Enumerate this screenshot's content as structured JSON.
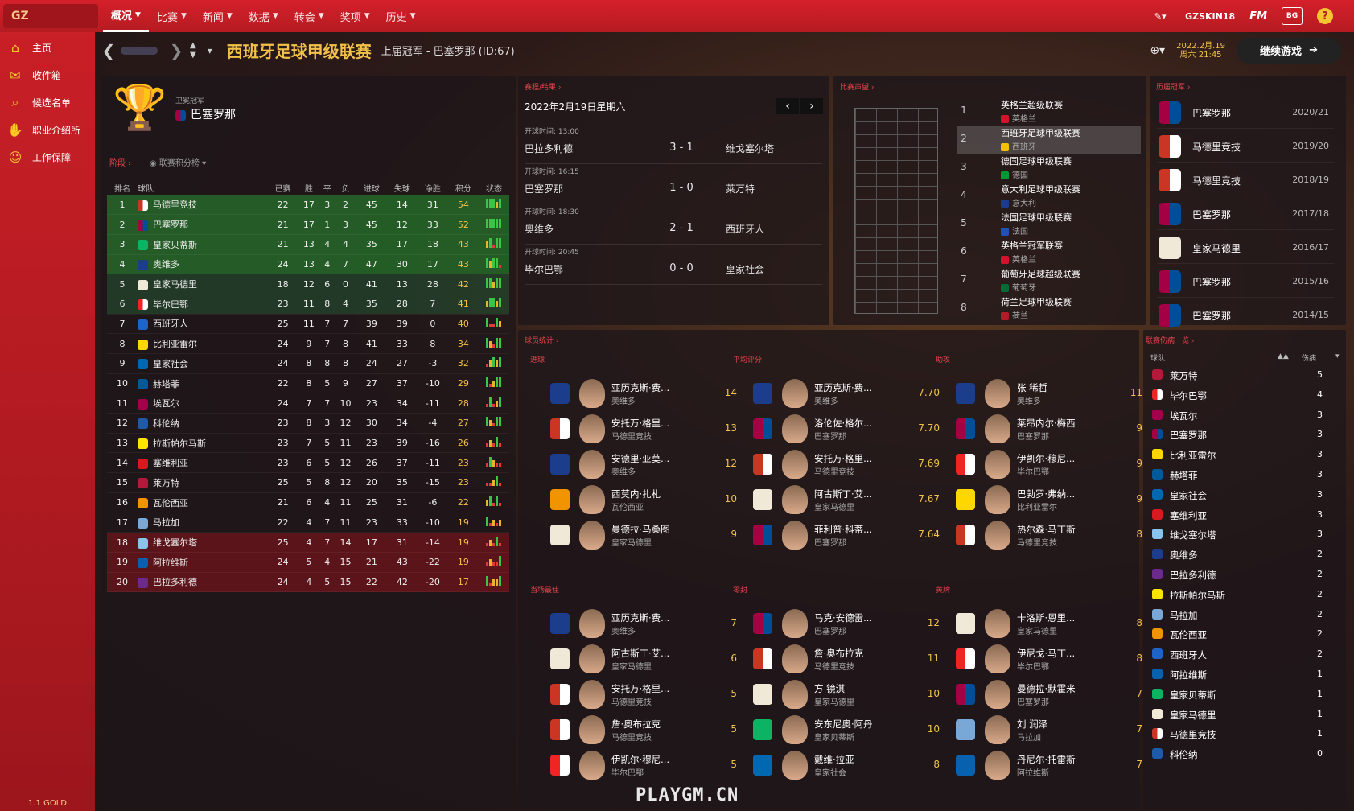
{
  "topbar": {
    "logo": "GZ",
    "nav": [
      {
        "label": "概况",
        "active": true
      },
      {
        "label": "比赛"
      },
      {
        "label": "新闻"
      },
      {
        "label": "数据"
      },
      {
        "label": "转会"
      },
      {
        "label": "奖项"
      },
      {
        "label": "历史"
      }
    ],
    "user": "GZSKIN18",
    "fm": "FM",
    "bg": "BG",
    "help": "?"
  },
  "sidebar": {
    "items": [
      {
        "label": "主页",
        "icon": "home-icon"
      },
      {
        "label": "收件箱",
        "icon": "inbox-icon"
      },
      {
        "label": "候选名单",
        "icon": "search-icon"
      },
      {
        "label": "职业介绍所",
        "icon": "handshake-icon"
      },
      {
        "label": "工作保障",
        "icon": "people-icon"
      }
    ],
    "footer": "1.1 GOLD"
  },
  "header": {
    "title": "西班牙足球甲级联赛",
    "subtitle": "上届冠军 - 巴塞罗那 (ID:67)",
    "date_line1": "2022.2月.19",
    "date_line2": "周六 21:45",
    "continue": "继续游戏"
  },
  "champion": {
    "label": "卫冕冠军",
    "team": "巴塞罗那"
  },
  "table": {
    "stage_label": "阶段",
    "toggle_label": "联赛积分榜",
    "headers": [
      "排名",
      "球队",
      "已赛",
      "胜",
      "平",
      "负",
      "进球",
      "失球",
      "净胜",
      "积分",
      "状态"
    ],
    "rows": [
      [
        "1",
        "马德里竞技",
        "22",
        "17",
        "3",
        "2",
        "45",
        "14",
        "31",
        "54"
      ],
      [
        "2",
        "巴塞罗那",
        "21",
        "17",
        "1",
        "3",
        "45",
        "12",
        "33",
        "52"
      ],
      [
        "3",
        "皇家贝蒂斯",
        "21",
        "13",
        "4",
        "4",
        "35",
        "17",
        "18",
        "43"
      ],
      [
        "4",
        "奥维多",
        "24",
        "13",
        "4",
        "7",
        "47",
        "30",
        "17",
        "43"
      ],
      [
        "5",
        "皇家马德里",
        "18",
        "12",
        "6",
        "0",
        "41",
        "13",
        "28",
        "42"
      ],
      [
        "6",
        "毕尔巴鄂",
        "23",
        "11",
        "8",
        "4",
        "35",
        "28",
        "7",
        "41"
      ],
      [
        "7",
        "西班牙人",
        "25",
        "11",
        "7",
        "7",
        "39",
        "39",
        "0",
        "40"
      ],
      [
        "8",
        "比利亚雷尔",
        "24",
        "9",
        "7",
        "8",
        "41",
        "33",
        "8",
        "34"
      ],
      [
        "9",
        "皇家社会",
        "24",
        "8",
        "8",
        "8",
        "24",
        "27",
        "-3",
        "32"
      ],
      [
        "10",
        "赫塔菲",
        "22",
        "8",
        "5",
        "9",
        "27",
        "37",
        "-10",
        "29"
      ],
      [
        "11",
        "埃瓦尔",
        "24",
        "7",
        "7",
        "10",
        "23",
        "34",
        "-11",
        "28"
      ],
      [
        "12",
        "科伦纳",
        "23",
        "8",
        "3",
        "12",
        "30",
        "34",
        "-4",
        "27"
      ],
      [
        "13",
        "拉斯帕尔马斯",
        "23",
        "7",
        "5",
        "11",
        "23",
        "39",
        "-16",
        "26"
      ],
      [
        "14",
        "塞维利亚",
        "23",
        "6",
        "5",
        "12",
        "26",
        "37",
        "-11",
        "23"
      ],
      [
        "15",
        "莱万特",
        "25",
        "5",
        "8",
        "12",
        "20",
        "35",
        "-15",
        "23"
      ],
      [
        "16",
        "瓦伦西亚",
        "21",
        "6",
        "4",
        "11",
        "25",
        "31",
        "-6",
        "22"
      ],
      [
        "17",
        "马拉加",
        "22",
        "4",
        "7",
        "11",
        "23",
        "33",
        "-10",
        "19"
      ],
      [
        "18",
        "维戈塞尔塔",
        "25",
        "4",
        "7",
        "14",
        "17",
        "31",
        "-14",
        "19"
      ],
      [
        "19",
        "阿拉维斯",
        "24",
        "5",
        "4",
        "15",
        "21",
        "43",
        "-22",
        "19"
      ],
      [
        "20",
        "巴拉多利德",
        "24",
        "4",
        "5",
        "15",
        "22",
        "42",
        "-20",
        "17"
      ]
    ]
  },
  "fixtures": {
    "title": "赛程/结果",
    "date": "2022年2月19日星期六",
    "prev": "‹",
    "next": "›",
    "items": [
      {
        "time": "开球时间: 13:00",
        "home": "巴拉多利德",
        "score": "3 - 1",
        "away": "维戈塞尔塔"
      },
      {
        "time": "开球时间: 16:15",
        "home": "巴塞罗那",
        "score": "1 - 0",
        "away": "莱万特"
      },
      {
        "time": "开球时间: 18:30",
        "home": "奥维多",
        "score": "2 - 1",
        "away": "西班牙人"
      },
      {
        "time": "开球时间: 20:45",
        "home": "毕尔巴鄂",
        "score": "0 - 0",
        "away": "皇家社会"
      }
    ]
  },
  "reputation": {
    "title": "比赛声望",
    "items": [
      {
        "rank": "1",
        "name": "英格兰超级联赛",
        "country": "英格兰"
      },
      {
        "rank": "2",
        "name": "西班牙足球甲级联赛",
        "country": "西班牙"
      },
      {
        "rank": "3",
        "name": "德国足球甲级联赛",
        "country": "德国"
      },
      {
        "rank": "4",
        "name": "意大利足球甲级联赛",
        "country": "意大利"
      },
      {
        "rank": "5",
        "name": "法国足球甲级联赛",
        "country": "法国"
      },
      {
        "rank": "6",
        "name": "英格兰冠军联赛",
        "country": "英格兰"
      },
      {
        "rank": "7",
        "name": "葡萄牙足球超级联赛",
        "country": "葡萄牙"
      },
      {
        "rank": "8",
        "name": "荷兰足球甲级联赛",
        "country": "荷兰"
      }
    ]
  },
  "history": {
    "title": "历届冠军",
    "items": [
      {
        "team": "巴塞罗那",
        "season": "2020/21"
      },
      {
        "team": "马德里竞技",
        "season": "2019/20"
      },
      {
        "team": "马德里竞技",
        "season": "2018/19"
      },
      {
        "team": "巴塞罗那",
        "season": "2017/18"
      },
      {
        "team": "皇家马德里",
        "season": "2016/17"
      },
      {
        "team": "巴塞罗那",
        "season": "2015/16"
      },
      {
        "team": "巴塞罗那",
        "season": "2014/15"
      }
    ]
  },
  "player_stats": {
    "title": "球员统计",
    "categories": [
      {
        "label": "进球",
        "players": [
          {
            "name": "亚历克斯·费...",
            "club": "奥维多",
            "value": "14"
          },
          {
            "name": "安托万·格里...",
            "club": "马德里竞技",
            "value": "13"
          },
          {
            "name": "安德里·亚莫...",
            "club": "奥维多",
            "value": "12"
          },
          {
            "name": "西莫内·扎札",
            "club": "瓦伦西亚",
            "value": "10"
          },
          {
            "name": "曼德拉·马桑图",
            "club": "皇家马德里",
            "value": "9"
          }
        ]
      },
      {
        "label": "平均评分",
        "players": [
          {
            "name": "亚历克斯·费...",
            "club": "奥维多",
            "value": "7.70"
          },
          {
            "name": "洛伦佐·格尔...",
            "club": "巴塞罗那",
            "value": "7.70"
          },
          {
            "name": "安托万·格里...",
            "club": "马德里竞技",
            "value": "7.69"
          },
          {
            "name": "阿古斯丁·艾...",
            "club": "皇家马德里",
            "value": "7.67"
          },
          {
            "name": "菲利普·科蒂...",
            "club": "巴塞罗那",
            "value": "7.64"
          }
        ]
      },
      {
        "label": "助攻",
        "players": [
          {
            "name": "张 稀哲",
            "club": "奥维多",
            "value": "11"
          },
          {
            "name": "莱昂内尔·梅西",
            "club": "巴塞罗那",
            "value": "9"
          },
          {
            "name": "伊凯尔·穆尼...",
            "club": "毕尔巴鄂",
            "value": "9"
          },
          {
            "name": "巴勃罗·弗纳...",
            "club": "比利亚雷尔",
            "value": "9"
          },
          {
            "name": "热尔森·马丁斯",
            "club": "马德里竞技",
            "value": "8"
          }
        ]
      },
      {
        "label": "当场最佳",
        "players": [
          {
            "name": "亚历克斯·费...",
            "club": "奥维多",
            "value": "7"
          },
          {
            "name": "阿古斯丁·艾...",
            "club": "皇家马德里",
            "value": "6"
          },
          {
            "name": "安托万·格里...",
            "club": "马德里竞技",
            "value": "5"
          },
          {
            "name": "詹·奥布拉克",
            "club": "马德里竞技",
            "value": "5"
          },
          {
            "name": "伊凯尔·穆尼...",
            "club": "毕尔巴鄂",
            "value": "5"
          }
        ]
      },
      {
        "label": "零封",
        "players": [
          {
            "name": "马克·安德雷...",
            "club": "巴塞罗那",
            "value": "12"
          },
          {
            "name": "詹·奥布拉克",
            "club": "马德里竞技",
            "value": "11"
          },
          {
            "name": "方 镜淇",
            "club": "皇家马德里",
            "value": "10"
          },
          {
            "name": "安东尼奥·阿丹",
            "club": "皇家贝蒂斯",
            "value": "10"
          },
          {
            "name": "戴维·拉亚",
            "club": "皇家社会",
            "value": "8"
          }
        ]
      },
      {
        "label": "黄牌",
        "players": [
          {
            "name": "卡洛斯·恩里...",
            "club": "皇家马德里",
            "value": "8"
          },
          {
            "name": "伊尼戈·马丁...",
            "club": "毕尔巴鄂",
            "value": "8"
          },
          {
            "name": "曼德拉·默霍米",
            "club": "巴塞罗那",
            "value": "7"
          },
          {
            "name": "刘 润泽",
            "club": "马拉加",
            "value": "7"
          },
          {
            "name": "丹尼尔·托雷斯",
            "club": "阿拉维斯",
            "value": "7"
          }
        ]
      }
    ]
  },
  "injuries": {
    "title": "联赛伤病一览",
    "col_team": "球队",
    "col_inj": "伤病",
    "items": [
      {
        "team": "莱万特",
        "count": "5"
      },
      {
        "team": "毕尔巴鄂",
        "count": "4"
      },
      {
        "team": "埃瓦尔",
        "count": "3"
      },
      {
        "team": "巴塞罗那",
        "count": "3"
      },
      {
        "team": "比利亚雷尔",
        "count": "3"
      },
      {
        "team": "赫塔菲",
        "count": "3"
      },
      {
        "team": "皇家社会",
        "count": "3"
      },
      {
        "team": "塞维利亚",
        "count": "3"
      },
      {
        "team": "维戈塞尔塔",
        "count": "3"
      },
      {
        "team": "奥维多",
        "count": "2"
      },
      {
        "team": "巴拉多利德",
        "count": "2"
      },
      {
        "team": "拉斯帕尔马斯",
        "count": "2"
      },
      {
        "team": "马拉加",
        "count": "2"
      },
      {
        "team": "瓦伦西亚",
        "count": "2"
      },
      {
        "team": "西班牙人",
        "count": "2"
      },
      {
        "team": "阿拉维斯",
        "count": "1"
      },
      {
        "team": "皇家贝蒂斯",
        "count": "1"
      },
      {
        "team": "皇家马德里",
        "count": "1"
      },
      {
        "team": "马德里竞技",
        "count": "1"
      },
      {
        "team": "科伦纳",
        "count": "0"
      }
    ]
  },
  "watermark": "PLAYGM.CN",
  "colors": {
    "accent": "#c91f27",
    "gold": "#f2c14a",
    "cl_zone": "#2a8a34",
    "relegation": "#8c141c"
  }
}
